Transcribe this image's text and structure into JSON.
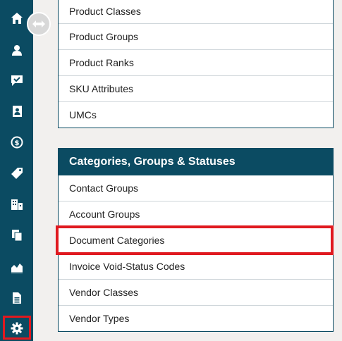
{
  "sidebar": {
    "icons": [
      "home-icon",
      "contacts-icon",
      "messages-icon",
      "address-book-icon",
      "dollar-icon",
      "tag-icon",
      "buildings-icon",
      "documents-icon",
      "chart-icon",
      "file-icon",
      "gear-icon"
    ],
    "background": "#0b4b62",
    "highlight_color": "#e0191f"
  },
  "product_card": {
    "items": [
      "Product Classes",
      "Product Groups",
      "Product Ranks",
      "SKU Attributes",
      "UMCs"
    ]
  },
  "categories_card": {
    "title": "Categories, Groups & Statuses",
    "items": [
      "Contact Groups",
      "Account Groups",
      "Document Categories",
      "Invoice Void-Status Codes",
      "Vendor Classes",
      "Vendor Types"
    ]
  }
}
